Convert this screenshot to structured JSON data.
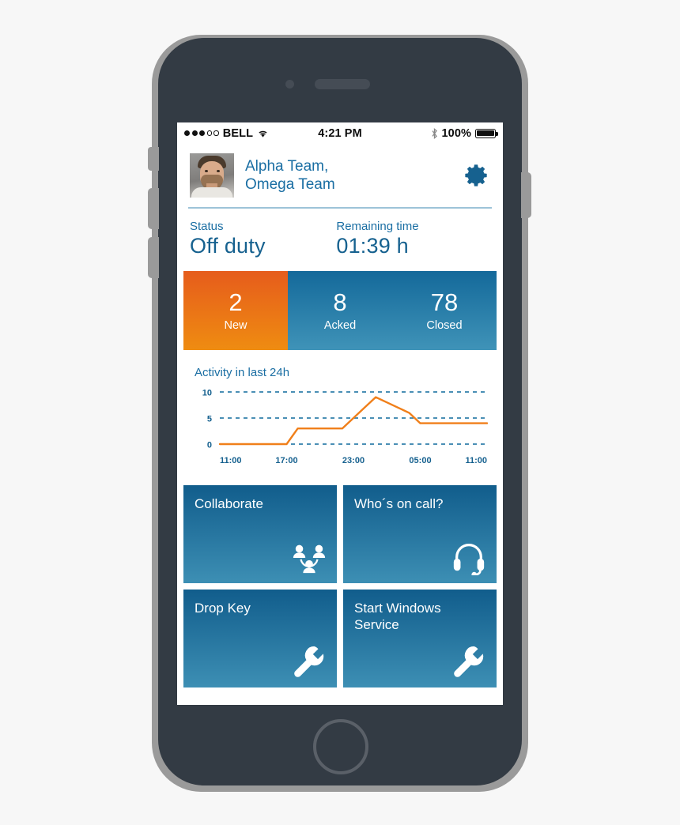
{
  "status_bar": {
    "signal_dots_filled": 3,
    "signal_dots_total": 5,
    "carrier": "BELL",
    "wifi_icon": "wifi-icon",
    "time": "4:21 PM",
    "bluetooth_icon": "bluetooth-icon",
    "battery_percent": "100%",
    "battery_icon": "battery-full-icon"
  },
  "header": {
    "avatar_icon": "user-avatar",
    "team_line1": "Alpha Team,",
    "team_line2": "Omega Team",
    "settings_icon": "gear-icon"
  },
  "status_section": {
    "status_label": "Status",
    "status_value": "Off duty",
    "remaining_label": "Remaining time",
    "remaining_value": "01:39 h"
  },
  "counters": [
    {
      "value": "2",
      "label": "New",
      "color": "#e65c1c"
    },
    {
      "value": "8",
      "label": "Acked",
      "color": "#14699a"
    },
    {
      "value": "78",
      "label": "Closed",
      "color": "#14699a"
    }
  ],
  "chart_data": {
    "type": "line",
    "title": "Activity in last 24h",
    "xlabel": "",
    "ylabel": "",
    "x": [
      "11:00",
      "12:00",
      "13:00",
      "14:00",
      "15:00",
      "16:00",
      "17:00",
      "18:00",
      "19:00",
      "20:00",
      "21:00",
      "22:00",
      "23:00",
      "00:00",
      "01:00",
      "02:00",
      "03:00",
      "04:00",
      "05:00",
      "06:00",
      "07:00",
      "08:00",
      "09:00",
      "10:00",
      "11:00"
    ],
    "values": [
      0,
      0,
      0,
      0,
      0,
      0,
      0,
      3,
      3,
      3,
      3,
      3,
      5,
      7,
      9,
      8,
      7,
      6,
      4,
      4,
      4,
      4,
      4,
      4,
      4
    ],
    "tick_labels": [
      "11:00",
      "17:00",
      "23:00",
      "05:00",
      "11:00"
    ],
    "y_ticks": [
      "0",
      "5",
      "10"
    ],
    "ylim": [
      0,
      10
    ],
    "grid": true,
    "legend": "none",
    "line_color": "#f07f1a",
    "grid_color": "#4a8fb5"
  },
  "tiles": [
    {
      "label": "Collaborate",
      "icon": "collaborate-icon"
    },
    {
      "label": "Who´s on call?",
      "icon": "headset-icon"
    },
    {
      "label": "Drop Key",
      "icon": "wrench-icon"
    },
    {
      "label": "Start Windows Service",
      "icon": "wrench-icon"
    }
  ],
  "theme": {
    "brand_blue": "#16618f",
    "link_blue": "#1a6ea3",
    "orange": "#e65c1c",
    "tile_blue_top": "#115d8c",
    "tile_blue_bottom": "#3d8fb4"
  }
}
